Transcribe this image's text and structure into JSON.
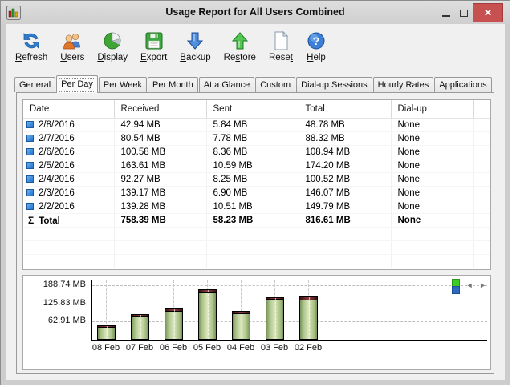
{
  "window": {
    "title": "Usage Report for All Users Combined",
    "controls": {
      "close_glyph": "✕"
    }
  },
  "toolbar": {
    "buttons": [
      {
        "name": "refresh",
        "pre": "",
        "key": "R",
        "post": "efresh"
      },
      {
        "name": "users",
        "pre": "",
        "key": "U",
        "post": "sers"
      },
      {
        "name": "display",
        "pre": "",
        "key": "D",
        "post": "isplay"
      },
      {
        "name": "export",
        "pre": "",
        "key": "E",
        "post": "xport"
      },
      {
        "name": "backup",
        "pre": "",
        "key": "B",
        "post": "ackup"
      },
      {
        "name": "restore",
        "pre": "Re",
        "key": "s",
        "post": "tore"
      },
      {
        "name": "reset",
        "pre": "Rese",
        "key": "t",
        "post": ""
      },
      {
        "name": "help",
        "pre": "",
        "key": "H",
        "post": "elp"
      }
    ]
  },
  "tabs": {
    "items": [
      "General",
      "Per Day",
      "Per Week",
      "Per Month",
      "At a Glance",
      "Custom",
      "Dial-up Sessions",
      "Hourly Rates",
      "Applications"
    ],
    "active": "Per Day",
    "active_index": 1
  },
  "table": {
    "columns": [
      "Date",
      "Received",
      "Sent",
      "Total",
      "Dial-up"
    ],
    "rows": [
      {
        "date": "2/8/2016",
        "received": "42.94 MB",
        "sent": "5.84 MB",
        "total": "48.78 MB",
        "dialup": "None"
      },
      {
        "date": "2/7/2016",
        "received": "80.54 MB",
        "sent": "7.78 MB",
        "total": "88.32 MB",
        "dialup": "None"
      },
      {
        "date": "2/6/2016",
        "received": "100.58 MB",
        "sent": "8.36 MB",
        "total": "108.94 MB",
        "dialup": "None"
      },
      {
        "date": "2/5/2016",
        "received": "163.61 MB",
        "sent": "10.59 MB",
        "total": "174.20 MB",
        "dialup": "None"
      },
      {
        "date": "2/4/2016",
        "received": "92.27 MB",
        "sent": "8.25 MB",
        "total": "100.52 MB",
        "dialup": "None"
      },
      {
        "date": "2/3/2016",
        "received": "139.17 MB",
        "sent": "6.90 MB",
        "total": "146.07 MB",
        "dialup": "None"
      },
      {
        "date": "2/2/2016",
        "received": "139.28 MB",
        "sent": "10.51 MB",
        "total": "149.79 MB",
        "dialup": "None"
      }
    ],
    "total": {
      "sigma": "Σ",
      "label": "Total",
      "received": "758.39 MB",
      "sent": "58.23 MB",
      "total": "816.61 MB",
      "dialup": "None"
    }
  },
  "chart_data": {
    "type": "bar",
    "stacked": true,
    "categories": [
      "08 Feb",
      "07 Feb",
      "06 Feb",
      "05 Feb",
      "04 Feb",
      "03 Feb",
      "02 Feb"
    ],
    "series": [
      {
        "name": "Received",
        "color": "#a9c083",
        "values": [
          42.94,
          80.54,
          100.58,
          163.61,
          92.27,
          139.17,
          139.28
        ]
      },
      {
        "name": "Sent",
        "color": "#6b2424",
        "values": [
          5.84,
          7.78,
          8.36,
          10.59,
          8.25,
          6.9,
          10.51
        ]
      }
    ],
    "unit": "MB",
    "y_ticks": [
      {
        "label": "188.74 MB",
        "value": 188.74
      },
      {
        "label": "125.83 MB",
        "value": 125.83
      },
      {
        "label": "62.91 MB",
        "value": 62.91
      }
    ],
    "ylim": [
      0,
      200
    ],
    "grid": "dashed",
    "legend": {
      "position": "top-right",
      "swatch_colors": [
        "#3ccc23",
        "#3069c0"
      ]
    },
    "nav": {
      "left": "◄",
      "right": "►"
    }
  },
  "colors": {
    "close_button": "#c75050",
    "bar_green": "#a9c083",
    "bar_cap_red": "#6b2424",
    "bullet_blue": "#2272cc"
  }
}
